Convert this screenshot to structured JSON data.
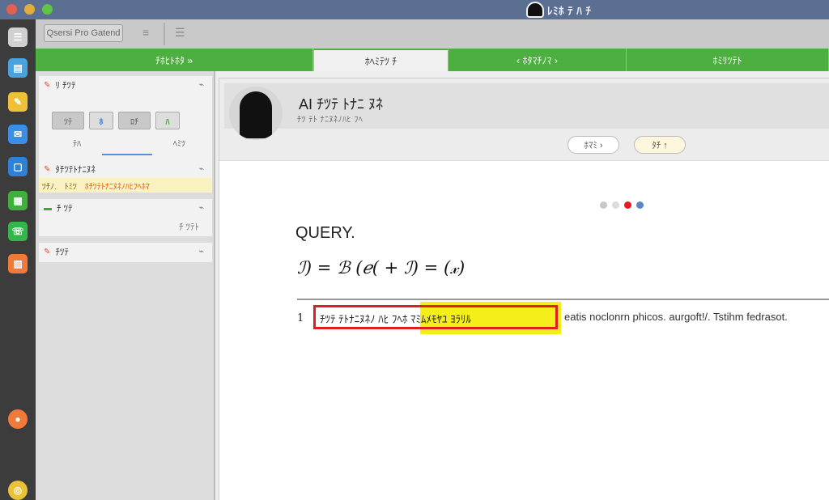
{
  "window": {
    "title": "ﾚﾐﾎ ﾃ ﾊ ﾁ",
    "colors": {
      "titlebar": "#5b6f93",
      "tab_bar": "#4caf3f",
      "highlight_red": "#e21d1d",
      "highlight_yellow": "#f4ee1a"
    }
  },
  "toolbar": {
    "search_label": "Qsersi Pro Gatend",
    "icons": [
      "menu-lines-icon",
      "list-lines-icon"
    ]
  },
  "dock": {
    "items": [
      {
        "icon": "menu-icon",
        "glyph": "☰",
        "color": "#d0d0d0"
      },
      {
        "icon": "calendar-icon",
        "glyph": "▤",
        "color": "#4aa3df"
      },
      {
        "icon": "notes-icon",
        "glyph": "✎",
        "color": "#f0c038"
      },
      {
        "icon": "chat-icon",
        "glyph": "✉",
        "color": "#3b8ee6"
      },
      {
        "icon": "doc-icon",
        "glyph": "▢",
        "color": "#2f80d8"
      },
      {
        "icon": "app-green-icon",
        "glyph": "▦",
        "color": "#3fb03a"
      },
      {
        "icon": "phone-icon",
        "glyph": "☏",
        "color": "#34b64a"
      },
      {
        "icon": "app-orange-icon",
        "glyph": "▧",
        "color": "#f07a3a"
      },
      {
        "icon": "user-orange-icon",
        "glyph": "●",
        "color": "#f07a3a"
      },
      {
        "icon": "chrome-icon",
        "glyph": "◎",
        "color": "#e9c23a"
      }
    ]
  },
  "tabs": [
    {
      "label": "ﾁﾎﾋﾄﾎﾀ »"
    },
    {
      "label": "ﾎﾍﾐﾃﾂ ﾁ"
    },
    {
      "label": "‹   ﾎﾀﾏﾁﾉﾏ   ›"
    },
    {
      "label": "ﾎﾐﾘﾂﾃﾄ"
    }
  ],
  "sidebar": {
    "cards": [
      {
        "title": "ﾘ ﾁﾂﾃ",
        "chips": [
          "ﾂﾃ",
          "ﾎ",
          "ﾛﾁ",
          "ﾊ"
        ],
        "labels": [
          "ﾃﾊ",
          "ﾍﾐﾂ"
        ]
      },
      {
        "title": "ﾀﾁﾂﾃﾄﾅﾆﾇﾈ",
        "highlight": [
          "ﾂﾁﾉ.",
          "ﾄﾐﾂ",
          "ﾎﾁﾂﾃﾄﾅﾆﾇﾈﾉﾊﾋﾌﾍﾎﾏ"
        ]
      },
      {
        "title": "ﾁ ﾂﾃ",
        "sub": "ﾁ ﾂﾃﾄ"
      },
      {
        "title": "ﾁﾂﾃ"
      }
    ]
  },
  "profile": {
    "name": "AI ﾁﾂﾃ ﾄﾅﾆ ﾇﾈ",
    "subtitle": "ﾁﾂ ﾃﾄ ﾅﾆﾇﾈﾉﾊﾋ ﾌﾍ",
    "pill1": "ﾎﾏﾐ ›",
    "pill2": "ﾀﾁ ↑"
  },
  "content": {
    "query_label": "QUERY.",
    "equation": "ℐ) = ℬ (ℯ( + ℐ) = (𝓍)",
    "line_number": "1",
    "highlighted_snippet": "ﾁﾂﾃ ﾃﾄﾅﾆﾇﾈﾉ ﾊﾋ ﾌﾍﾎ ﾏﾐﾑﾒﾓﾔﾕ ﾖﾗﾘﾙ",
    "rest_text": "eatis noclonrn phicos. aurgoft!/. Tstihm fedrasot.",
    "carousel_dots": [
      "#c8c8c8",
      "#dcdcdc",
      "#e21d1d",
      "#5b86c4"
    ]
  }
}
